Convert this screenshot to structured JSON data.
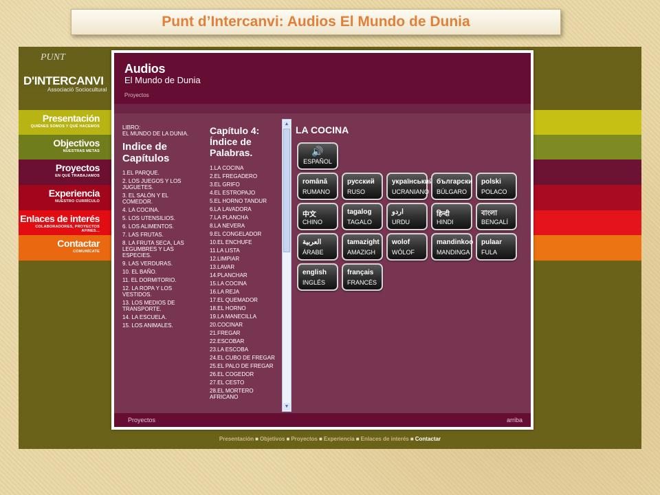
{
  "slide_title": "Punt d’Intercanvi: Audios El Mundo de Dunia",
  "logo": {
    "top": "PUNT",
    "name": "D'INTERCANVI",
    "sub": "Associació Sociocultural"
  },
  "nav": [
    {
      "title": "Presentación",
      "sub": "QUIÉNES SOMOS Y QUÉ HACEMOS",
      "color": "#b8b414",
      "bar": "#c5c013"
    },
    {
      "title": "Objectivos",
      "sub": "NUESTRAS METAS",
      "color": "#6f7d1d",
      "bar": "#7d8b22"
    },
    {
      "title": "Proyectos",
      "sub": "EN QUÉ TRABAJAMOS",
      "color": "#6b1030",
      "bar": "#6c1232"
    },
    {
      "title": "Experiencia",
      "sub": "NUESTRO CURRÍCULO",
      "color": "#a2061d",
      "bar": "#a90c22"
    },
    {
      "title": "Enlaces de interés",
      "sub": "COLABORADORES, PROYECTOS AFINES...",
      "color": "#e10d13",
      "bar": "#e4151a"
    },
    {
      "title": "Contactar",
      "sub": "COMUNÍCATE",
      "color": "#ea6910",
      "bar": "#ec7413"
    }
  ],
  "header": {
    "title": "Audios",
    "subtitle": "El Mundo de Dunia",
    "breadcrumb": "Proyectos"
  },
  "book": {
    "label": "LIBRO:",
    "name": "EL MUNDO DE LA DUNIA.",
    "index_title": "Indice de Capítulos",
    "chapters": [
      "1.EL PARQUE.",
      "2. LOS JUEGOS Y LOS JUGUETES.",
      "3. EL SALÓN Y EL COMEDOR.",
      "4. LA COCINA.",
      "5. LOS UTENSILIOS.",
      "6. LOS ALIMENTOS.",
      "7. LAS FRUTAS.",
      "8. LA FRUTA SECA, LAS LEGUMBRES Y LAS ESPECIES.",
      "9. LAS VERDURAS.",
      "10. EL BAÑO.",
      "11. EL DORMITORIO.",
      "12. LA ROPA Y LOS VESTIDOS.",
      "13. LOS MEDIOS DE TRANSPORTE.",
      "14. LA ESCUELA.",
      "15. LOS ANIMALES."
    ]
  },
  "chapter": {
    "title": "Capítulo 4: Índice de Palabras.",
    "words": [
      "1.LA COCINA",
      "2.EL FREGADERO",
      "3.EL GRIFO",
      "4.EL ESTROPAJO",
      "5.EL HORNO TANDUR",
      "6.LA LAVADORA",
      "7.LA PLANCHA",
      "8.LA NEVERA",
      "9.EL CONGELADOR",
      "10.EL ENCHUFE",
      "11.LA LISTA",
      "12.LIMPIAR",
      "13.LAVAR",
      "14.PLANCHAR",
      "15.LA COCINA",
      "16.LA REJA",
      "17.EL QUEMADOR",
      "18.EL HORNO",
      "19.LA MANECILLA",
      "20.COCINAR",
      "21.FREGAR",
      "22.ESCOBAR",
      "23.LA ESCOBA",
      "24.EL CUBO DE FREGAR",
      "25.EL PALO DE FREGAR",
      "26.EL COGEDOR",
      "27.EL CESTO",
      "28.EL MORTERO AFRICANO"
    ]
  },
  "audio_title": "LA COCINA",
  "languages": {
    "espanol": {
      "icon": "speaker-icon",
      "glyph": "🔊",
      "label": "ESPAÑOL"
    },
    "rows": [
      [
        {
          "native": "română",
          "label": "RUMANO"
        },
        {
          "native": "русский",
          "label": "RUSO"
        },
        {
          "native": "український",
          "label": "UCRANIANO"
        },
        {
          "native": "български",
          "label": "BÚLGARO"
        },
        {
          "native": "polski",
          "label": "POLACO"
        }
      ],
      [
        {
          "native": "中文",
          "label": "CHINO"
        },
        {
          "native": "tagalog",
          "label": "TAGALO"
        },
        {
          "native": "اردو",
          "label": "URDU"
        },
        {
          "native": "हिन्दी",
          "label": "HINDI"
        },
        {
          "native": "বাংলা",
          "label": "BENGALÍ"
        }
      ],
      [
        {
          "native": "العربية",
          "label": "ÁRABE"
        },
        {
          "native": "tamazight",
          "label": "AMAZIGH"
        },
        {
          "native": "wolof",
          "label": "WÓLOF"
        },
        {
          "native": "mandinkoo",
          "label": "MANDINGA"
        },
        {
          "native": "pulaar",
          "label": "FULA"
        }
      ],
      [
        {
          "native": "english",
          "label": "INGLÉS"
        },
        {
          "native": "français",
          "label": "FRANCÉS"
        }
      ]
    ]
  },
  "footer": {
    "left": "Proyectos",
    "right": "arriba"
  },
  "bottom_nav": [
    "Presentación",
    "Objetivos",
    "Proyectos",
    "Experiencia",
    "Enlaces de interés",
    "Contactar"
  ],
  "bottom_nav_separator": "■"
}
